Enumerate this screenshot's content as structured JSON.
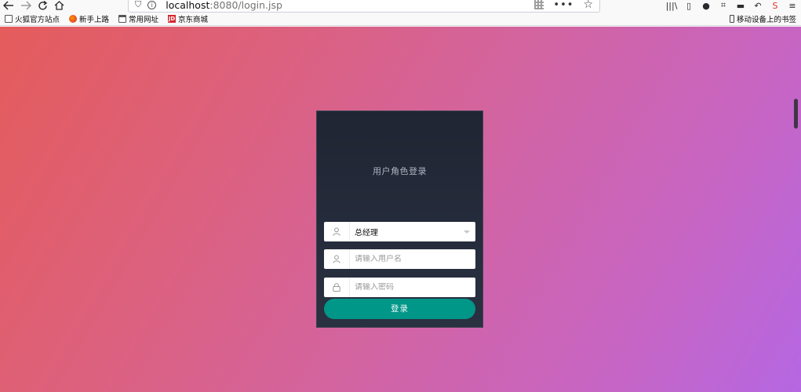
{
  "browser": {
    "url_host": "localhost",
    "url_path": ":8080/login.jsp",
    "menu_dots": "•••"
  },
  "bookmarks": {
    "items": [
      {
        "label": "火狐官方站点",
        "icon": "star-page-icon"
      },
      {
        "label": "新手上路",
        "icon": "firefox-icon"
      },
      {
        "label": "常用网址",
        "icon": "folder-icon"
      },
      {
        "label": "京东商城",
        "icon": "jd-icon"
      }
    ],
    "mobile": "移动设备上的书签"
  },
  "login": {
    "title": "用户角色登录",
    "role_selected": "总经理",
    "username_placeholder": "请输入用户名",
    "password_placeholder": "请输入密码",
    "submit_label": "登录"
  },
  "colors": {
    "card_bg": "#232a38",
    "button": "#009688",
    "gradient_start": "#e45c5b",
    "gradient_end": "#b567e2"
  }
}
